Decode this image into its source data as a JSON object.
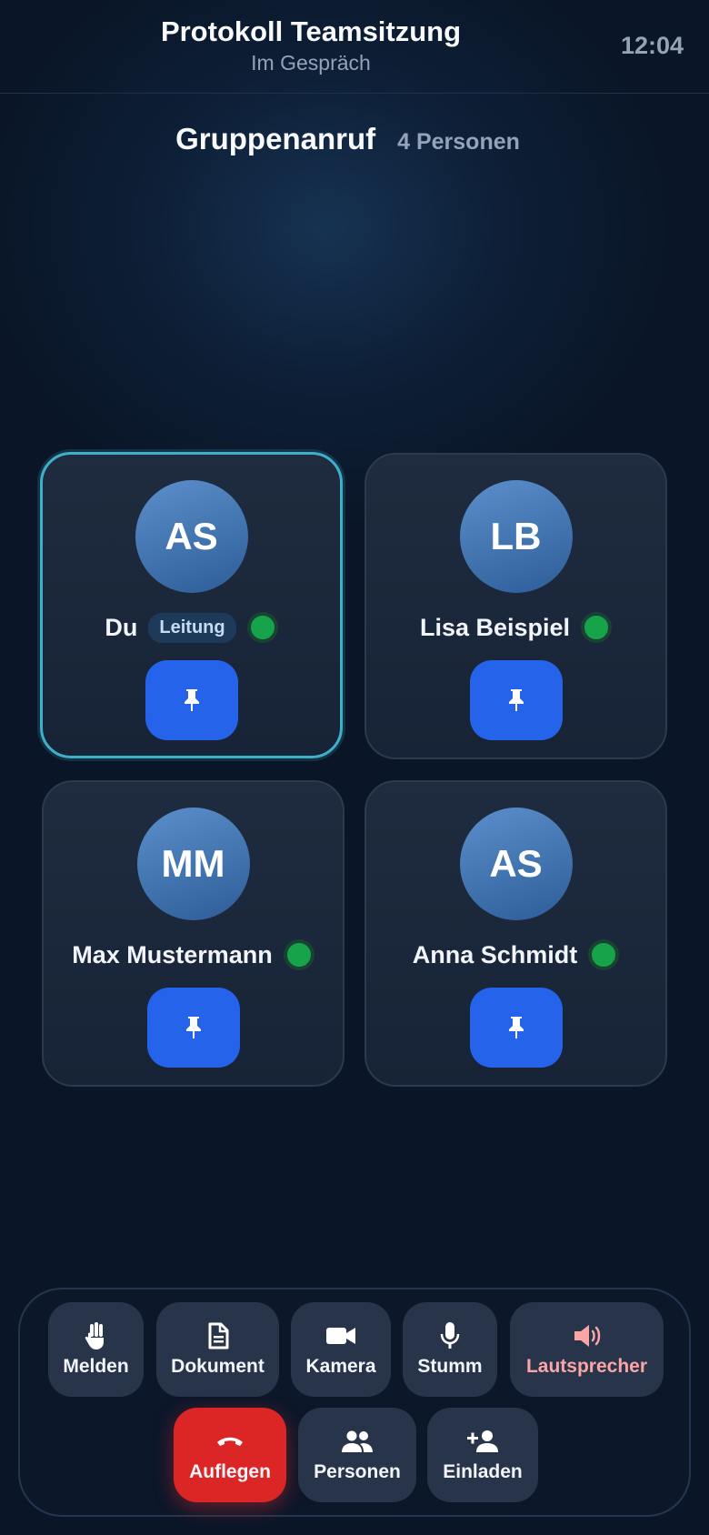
{
  "header": {
    "title": "Protokoll Teamsitzung",
    "subtitle": "Im Gespräch",
    "time": "12:04"
  },
  "call": {
    "heading": "Gruppenanruf",
    "count": "4 Personen"
  },
  "participants": [
    {
      "initials": "AS",
      "name": "Du",
      "role": "Leitung",
      "status": "online",
      "active": true
    },
    {
      "initials": "LB",
      "name": "Lisa Beispiel",
      "status": "online",
      "active": false
    },
    {
      "initials": "MM",
      "name": "Max Mustermann",
      "status": "online",
      "active": false
    },
    {
      "initials": "AS",
      "name": "Anna Schmidt",
      "status": "online",
      "active": false
    }
  ],
  "controls": {
    "raise_hand": {
      "label": "Melden",
      "icon": "hand-icon"
    },
    "document": {
      "label": "Dokument",
      "icon": "document-icon"
    },
    "camera": {
      "label": "Kamera",
      "icon": "video-camera-icon"
    },
    "mute": {
      "label": "Stumm",
      "icon": "microphone-icon"
    },
    "speaker": {
      "label": "Lautsprecher",
      "icon": "speaker-icon"
    },
    "hangup": {
      "label": "Auflegen",
      "icon": "hangup-icon"
    },
    "people": {
      "label": "Personen",
      "icon": "people-icon"
    },
    "invite": {
      "label": "Einladen",
      "icon": "add-person-icon"
    }
  },
  "colors": {
    "accent": "#2563eb",
    "online": "#16a34a",
    "hangup": "#dc2626",
    "active_border": "#3fb0c9"
  }
}
